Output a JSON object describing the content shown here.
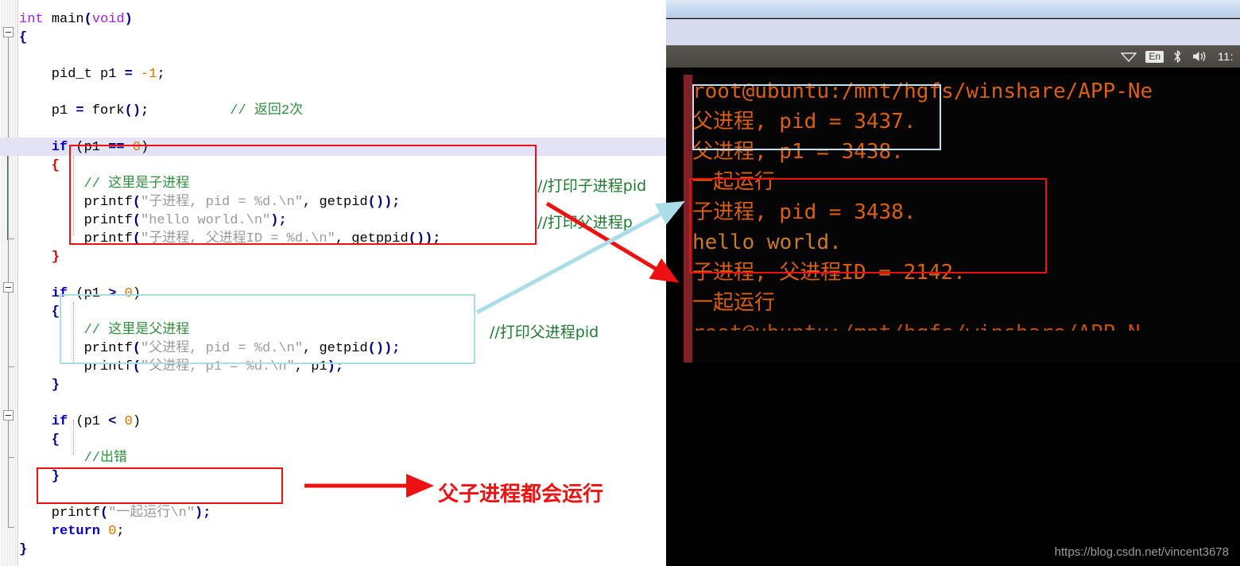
{
  "editor": {
    "lines": [
      {
        "indent": 0,
        "segments": [
          {
            "t": "int ",
            "c": "typ"
          },
          {
            "t": "main",
            "c": "plain"
          },
          {
            "t": "(",
            "c": "punc"
          },
          {
            "t": "void",
            "c": "typ"
          },
          {
            "t": ")",
            "c": "punc"
          }
        ]
      },
      {
        "indent": 0,
        "segments": [
          {
            "t": "{",
            "c": "punc"
          }
        ]
      },
      {
        "indent": 0,
        "segments": []
      },
      {
        "indent": 4,
        "segments": [
          {
            "t": "pid_t p1 ",
            "c": "plain"
          },
          {
            "t": "=",
            "c": "punc"
          },
          {
            "t": " ",
            "c": "plain"
          },
          {
            "t": "-1",
            "c": "num"
          },
          {
            "t": ";",
            "c": "plain"
          }
        ]
      },
      {
        "indent": 0,
        "segments": []
      },
      {
        "indent": 4,
        "segments": [
          {
            "t": "p1 ",
            "c": "plain"
          },
          {
            "t": "=",
            "c": "punc"
          },
          {
            "t": " fork",
            "c": "plain"
          },
          {
            "t": "();",
            "c": "punc"
          },
          {
            "t": "          ",
            "c": "plain"
          },
          {
            "t": "// 返回2次",
            "c": "cmt"
          }
        ]
      },
      {
        "indent": 0,
        "segments": []
      },
      {
        "indent": 4,
        "segments": [
          {
            "t": "if",
            "c": "kw"
          },
          {
            "t": " (p1 ",
            "c": "plain"
          },
          {
            "t": "==",
            "c": "punc"
          },
          {
            "t": " ",
            "c": "plain"
          },
          {
            "t": "0",
            "c": "num"
          },
          {
            "t": ")",
            "c": "plain"
          }
        ]
      },
      {
        "indent": 4,
        "segments": [
          {
            "t": "{",
            "c": "brace-red"
          }
        ]
      },
      {
        "indent": 8,
        "segments": [
          {
            "t": "// 这里是子进程",
            "c": "cmt"
          }
        ]
      },
      {
        "indent": 8,
        "segments": [
          {
            "t": "printf",
            "c": "plain"
          },
          {
            "t": "(",
            "c": "punc"
          },
          {
            "t": "\"子进程, pid = %d.\\n\"",
            "c": "str"
          },
          {
            "t": ", getpid",
            "c": "plain"
          },
          {
            "t": "());",
            "c": "punc"
          }
        ]
      },
      {
        "indent": 8,
        "segments": [
          {
            "t": "printf",
            "c": "plain"
          },
          {
            "t": "(",
            "c": "punc"
          },
          {
            "t": "\"hello world.\\n\"",
            "c": "str"
          },
          {
            "t": ");",
            "c": "punc"
          }
        ]
      },
      {
        "indent": 8,
        "segments": [
          {
            "t": "printf",
            "c": "plain"
          },
          {
            "t": "(",
            "c": "punc"
          },
          {
            "t": "\"子进程, 父进程ID = %d.\\n\"",
            "c": "str"
          },
          {
            "t": ", getppid",
            "c": "plain"
          },
          {
            "t": "());",
            "c": "punc"
          }
        ]
      },
      {
        "indent": 4,
        "segments": [
          {
            "t": "}",
            "c": "brace-red"
          }
        ]
      },
      {
        "indent": 0,
        "segments": []
      },
      {
        "indent": 4,
        "segments": [
          {
            "t": "if",
            "c": "kw"
          },
          {
            "t": " (p1 ",
            "c": "plain"
          },
          {
            "t": ">",
            "c": "punc"
          },
          {
            "t": " ",
            "c": "plain"
          },
          {
            "t": "0",
            "c": "num"
          },
          {
            "t": ")",
            "c": "plain"
          }
        ]
      },
      {
        "indent": 4,
        "segments": [
          {
            "t": "{",
            "c": "punc"
          }
        ]
      },
      {
        "indent": 8,
        "segments": [
          {
            "t": "// 这里是父进程",
            "c": "cmt"
          }
        ]
      },
      {
        "indent": 8,
        "segments": [
          {
            "t": "printf",
            "c": "plain"
          },
          {
            "t": "(",
            "c": "punc"
          },
          {
            "t": "\"父进程, pid = %d.\\n\"",
            "c": "str"
          },
          {
            "t": ", getpid",
            "c": "plain"
          },
          {
            "t": "());",
            "c": "punc"
          }
        ]
      },
      {
        "indent": 8,
        "segments": [
          {
            "t": "printf",
            "c": "plain"
          },
          {
            "t": "(",
            "c": "punc"
          },
          {
            "t": "\"父进程, p1 = %d.\\n\"",
            "c": "str"
          },
          {
            "t": ", p1",
            "c": "plain"
          },
          {
            "t": ");",
            "c": "punc"
          }
        ]
      },
      {
        "indent": 4,
        "segments": [
          {
            "t": "}",
            "c": "punc"
          }
        ]
      },
      {
        "indent": 0,
        "segments": []
      },
      {
        "indent": 4,
        "segments": [
          {
            "t": "if",
            "c": "kw"
          },
          {
            "t": " (p1 ",
            "c": "plain"
          },
          {
            "t": "<",
            "c": "punc"
          },
          {
            "t": " ",
            "c": "plain"
          },
          {
            "t": "0",
            "c": "num"
          },
          {
            "t": ")",
            "c": "plain"
          }
        ]
      },
      {
        "indent": 4,
        "segments": [
          {
            "t": "{",
            "c": "punc"
          }
        ]
      },
      {
        "indent": 8,
        "segments": [
          {
            "t": "//出错",
            "c": "cmt"
          }
        ]
      },
      {
        "indent": 4,
        "segments": [
          {
            "t": "}",
            "c": "punc"
          }
        ]
      },
      {
        "indent": 0,
        "segments": []
      },
      {
        "indent": 4,
        "segments": [
          {
            "t": "printf",
            "c": "plain"
          },
          {
            "t": "(",
            "c": "punc"
          },
          {
            "t": "\"一起运行\\n\"",
            "c": "str"
          },
          {
            "t": ");",
            "c": "punc"
          }
        ]
      },
      {
        "indent": 4,
        "segments": [
          {
            "t": "return",
            "c": "kw"
          },
          {
            "t": " ",
            "c": "plain"
          },
          {
            "t": "0",
            "c": "num"
          },
          {
            "t": ";",
            "c": "plain"
          }
        ]
      },
      {
        "indent": 0,
        "segments": [
          {
            "t": "}",
            "c": "punc"
          }
        ]
      }
    ],
    "annotations": {
      "child_pid_comment": "//打印子进程pid",
      "parent_pid_comment_cut": "//打印父进程p",
      "parent_pid_comment": "//打印父进程pid",
      "both_run_label": "父子进程都会运行"
    }
  },
  "desktop": {
    "tray": {
      "wifi_icon": "wifi-icon",
      "keyboard_layout": "En",
      "bluetooth_icon": "bluetooth-icon",
      "volume_icon": "volume-icon",
      "clock": "11:"
    }
  },
  "terminal": {
    "lines": [
      {
        "text": "root@ubuntu:/mnt/hgfs/winshare/APP-Ne",
        "style": "t-orange"
      },
      {
        "text": "父进程, pid = 3437.",
        "style": "t-orange"
      },
      {
        "text": "父进程, p1 = 3438.",
        "style": "t-orange"
      },
      {
        "text": "一起运行",
        "style": "t-orange"
      },
      {
        "text": "子进程, pid = 3438.",
        "style": "t-orange"
      },
      {
        "text": "hello world.",
        "style": "t-amber"
      },
      {
        "text": "子进程, 父进程ID = 2142.",
        "style": "t-orange"
      },
      {
        "text": "一起运行",
        "style": "t-orange"
      },
      {
        "text": "root@ubuntu:/mnt/hgfs/winshare/APP-N",
        "style": "t-orange"
      }
    ]
  },
  "watermark": "https://blog.csdn.net/vincent3678"
}
